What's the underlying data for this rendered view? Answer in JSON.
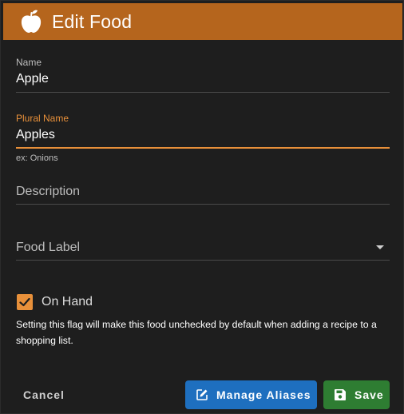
{
  "dialog": {
    "title": "Edit Food",
    "header_color": "#b5651d",
    "header_icon": "apple-icon"
  },
  "fields": {
    "name": {
      "label": "Name",
      "value": "Apple"
    },
    "plural_name": {
      "label": "Plural Name",
      "value": "Apples",
      "hint": "ex: Onions"
    },
    "description": {
      "placeholder": "Description",
      "value": ""
    },
    "food_label": {
      "placeholder": "Food Label",
      "value": ""
    }
  },
  "on_hand": {
    "label": "On Hand",
    "checked": true,
    "help": "Setting this flag will make this food unchecked by default when adding a recipe to a shopping list."
  },
  "actions": {
    "cancel_label": "Cancel",
    "manage_aliases_label": "Manage Aliases",
    "save_label": "Save"
  },
  "colors": {
    "accent": "#e8903a",
    "primary_button": "#1e6fbf",
    "save_button": "#2e7d32",
    "background": "#1e1e1e"
  }
}
